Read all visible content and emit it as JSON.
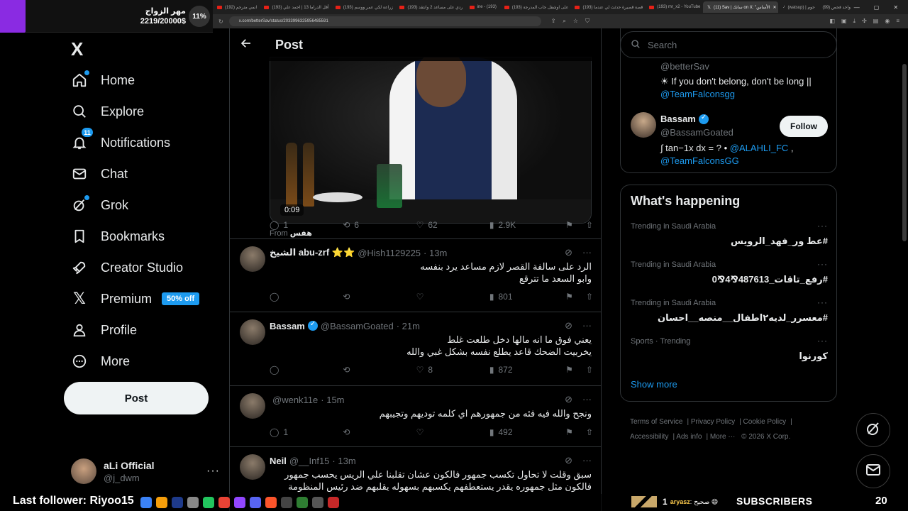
{
  "browser": {
    "tabs": [
      {
        "label": "(192) انمي مترجم",
        "active": false
      },
      {
        "label": "(193) أقل الدراما 13 | احمد علي",
        "active": false
      },
      {
        "label": "(193) زراعة لكي عمر ووسم",
        "active": false
      },
      {
        "label": "(193) ردي على مساعد 2 وانتقد",
        "active": false
      },
      {
        "label": "ine - (193)",
        "active": false
      },
      {
        "label": "(193) على اوشفل جاب المدرجة",
        "active": false
      },
      {
        "label": "(193) قصة قصيرة حدثت لي عندما",
        "active": false
      },
      {
        "label": "(193) mr_x2 - YouTube",
        "active": false
      },
      {
        "label": "(11) Sav | سانك on X: \"الأساس",
        "active": true
      },
      {
        "label": "(watsup) | حوم",
        "active": false
      },
      {
        "label": "(99) واحد فحص",
        "active": false
      }
    ],
    "url": "x.com/betterSav/status/2033996325956485591"
  },
  "goal_overlay": {
    "title": "مهر الزواج",
    "count": "2219/20000$",
    "percent": "11%"
  },
  "nav": {
    "logo": "X",
    "items": [
      {
        "label": "Home",
        "icon": "home-icon"
      },
      {
        "label": "Explore",
        "icon": "search-icon"
      },
      {
        "label": "Notifications",
        "icon": "bell-icon",
        "badge": "11"
      },
      {
        "label": "Chat",
        "icon": "mail-icon"
      },
      {
        "label": "Grok",
        "icon": "grok-icon"
      },
      {
        "label": "Bookmarks",
        "icon": "bookmark-icon"
      },
      {
        "label": "Creator Studio",
        "icon": "rocket-icon"
      },
      {
        "label": "Premium",
        "icon": "x-icon",
        "tag": "50% off"
      },
      {
        "label": "Profile",
        "icon": "person-icon"
      },
      {
        "label": "More",
        "icon": "more-circle-icon"
      }
    ],
    "post_button": "Post",
    "account": {
      "name": "aLi Official",
      "handle": "@j_dwm",
      "menu": "···"
    }
  },
  "post": {
    "header_title": "Post",
    "video_time": "0:09",
    "from_label": "From",
    "from_source": "هفس",
    "stats": {
      "replies": "1",
      "reposts": "6",
      "likes": "62",
      "views": "2.9K"
    }
  },
  "replies": [
    {
      "name": "الشيخ abu-zrf ⭐⭐",
      "handle": "@Hish1129225",
      "time": "· 13m",
      "text_lines": [
        "الرد على سالفة القصر لازم مساعد يرد بنفسه",
        "وابو السعد ما تترقع"
      ],
      "verified": false,
      "stats": {
        "replies": "",
        "reposts": "",
        "likes": "",
        "views": "801"
      }
    },
    {
      "name": "Bassam",
      "handle": "@BassamGoated",
      "time": "· 21m",
      "text_lines": [
        "يعني فوق ما انه مالها دخل طلعت غلط",
        "يخربيت الضحك قاعد يطلع نفسه بشكل غبي والله"
      ],
      "verified": true,
      "stats": {
        "replies": "",
        "reposts": "",
        "likes": "8",
        "views": "872"
      }
    },
    {
      "name": "",
      "handle": "@wenk11e",
      "time": "· 15m",
      "text_lines": [
        "ونجح والله فيه فئه من جمهورهم اي كلمه توديهم وتجيبهم"
      ],
      "verified": false,
      "stats": {
        "replies": "1",
        "reposts": "",
        "likes": "",
        "views": "492"
      }
    },
    {
      "name": "Neil",
      "handle": "@__Inf15",
      "time": "· 13m",
      "text_lines": [
        "سبق وقلت لا تحاول تكسب جمهور فالكون عشان تقلبنا علي الريس يحسب جمهور",
        "فالكون مثل جمهوره يقدر يستعطفهم يكسبهم بسهوله يقلبهم ضد رئيس المنظومة"
      ],
      "verified": false,
      "stats": {
        "replies": "",
        "reposts": "",
        "likes": "",
        "views": ""
      }
    }
  ],
  "search": {
    "placeholder": "Search"
  },
  "who_to_follow": {
    "first": {
      "handle": "@betterSav",
      "bio": "☀ If you don't belong, don't be long ||",
      "link": "@TeamFalconsgg"
    },
    "second": {
      "name": "Bassam",
      "handle": "@BassamGoated",
      "bio_prefix": "∫ tan−1x dx = ? •",
      "link1": "@ALAHLI_FC",
      "link2": "@TeamFalconsGG",
      "follow": "Follow"
    }
  },
  "trends": {
    "heading": "What's happening",
    "items": [
      {
        "category": "Trending in Saudi Arabia",
        "title": "#عط ور_فهد_الرويس"
      },
      {
        "category": "Trending in Saudi Arabia",
        "title": "#رفع_تاقات_487613⅋4⅋0"
      },
      {
        "category": "Trending in Saudi Arabia",
        "title": "#معسرر_لديه٢اطفال__منصه__احسان"
      },
      {
        "category": "Sports · Trending",
        "title": "كورنوا"
      }
    ],
    "show_more": "Show more"
  },
  "footer": [
    "Terms of Service",
    "Privacy Policy",
    "Cookie Policy",
    "Accessibility",
    "Ads info",
    "More ···",
    "© 2026 X Corp."
  ],
  "stream_bottom": {
    "last_follower": "Last follower: Riyoo15",
    "chat_user": "aryasz",
    "chat_msg": "صحيح 😄",
    "chat_num": "1",
    "subscribers_label": "SUBSCRIBERS",
    "subscribers_count": "20"
  },
  "colors": {
    "accent": "#1d9bf0",
    "bg": "#000000",
    "border": "#2f3336",
    "muted": "#71767b",
    "goal_bar": "#8a2be2"
  }
}
